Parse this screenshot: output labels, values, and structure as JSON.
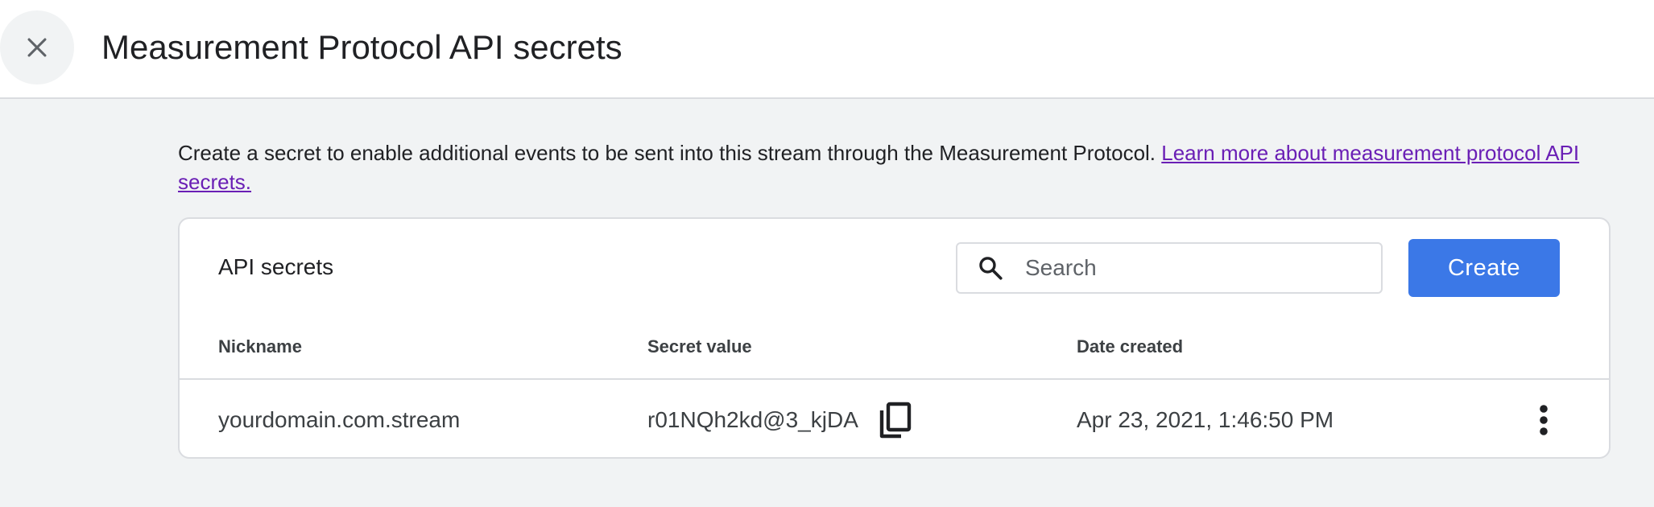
{
  "header": {
    "title": "Measurement Protocol API secrets",
    "close_icon": "close-icon"
  },
  "description": {
    "text": "Create a secret to enable additional events to be sent into this stream through the Measurement Protocol. ",
    "link_text": "Learn more about measurement protocol API secrets."
  },
  "card": {
    "title": "API secrets",
    "search": {
      "placeholder": "Search",
      "value": "",
      "icon": "search-icon"
    },
    "create_label": "Create",
    "columns": [
      "Nickname",
      "Secret value",
      "Date created"
    ],
    "rows": [
      {
        "nickname": "yourdomain.com.stream",
        "secret_value": "r01NQh2kd@3_kjDA",
        "date_created": "Apr 23, 2021, 1:46:50 PM"
      }
    ]
  },
  "colors": {
    "accent": "#3b78e7",
    "link": "#6a1fb5",
    "background": "#f1f3f4",
    "border": "#dadce0"
  }
}
